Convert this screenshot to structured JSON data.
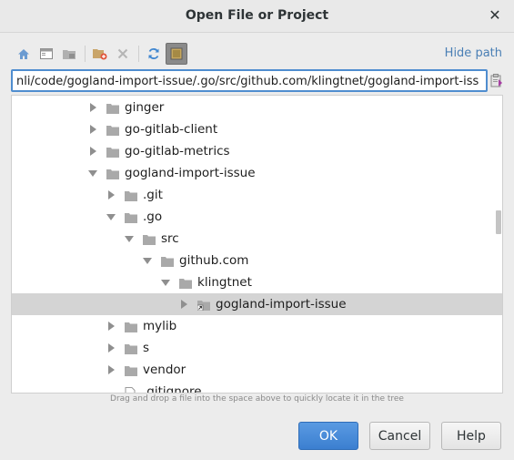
{
  "window": {
    "title": "Open File or Project",
    "close_label": "✕"
  },
  "toolbar": {
    "buttons": [
      {
        "name": "home-button",
        "icon": "home-icon"
      },
      {
        "name": "desktop-button",
        "icon": "desktop-icon"
      },
      {
        "name": "project-button",
        "icon": "project-folder-icon"
      },
      {
        "name": "new-folder-button",
        "icon": "new-folder-icon"
      },
      {
        "name": "delete-button",
        "icon": "delete-icon"
      },
      {
        "name": "refresh-button",
        "icon": "refresh-icon"
      },
      {
        "name": "show-hidden-button",
        "icon": "show-hidden-icon"
      }
    ],
    "hide_path_label": "Hide path"
  },
  "path": {
    "value": "nli/code/gogland-import-issue/.go/src/github.com/klingtnet/gogland-import-iss"
  },
  "tree": {
    "items": [
      {
        "label": "ginger",
        "depth": 0,
        "state": "collapsed",
        "type": "folder",
        "selected": false
      },
      {
        "label": "go-gitlab-client",
        "depth": 0,
        "state": "collapsed",
        "type": "folder",
        "selected": false
      },
      {
        "label": "go-gitlab-metrics",
        "depth": 0,
        "state": "collapsed",
        "type": "folder",
        "selected": false
      },
      {
        "label": "gogland-import-issue",
        "depth": 0,
        "state": "expanded",
        "type": "folder",
        "selected": false
      },
      {
        "label": ".git",
        "depth": 1,
        "state": "collapsed",
        "type": "folder",
        "selected": false
      },
      {
        "label": ".go",
        "depth": 1,
        "state": "expanded",
        "type": "folder",
        "selected": false
      },
      {
        "label": "src",
        "depth": 2,
        "state": "expanded",
        "type": "folder",
        "selected": false
      },
      {
        "label": "github.com",
        "depth": 3,
        "state": "expanded",
        "type": "folder",
        "selected": false
      },
      {
        "label": "klingtnet",
        "depth": 4,
        "state": "expanded",
        "type": "folder",
        "selected": false
      },
      {
        "label": "gogland-import-issue",
        "depth": 5,
        "state": "collapsed",
        "type": "symlink",
        "selected": true
      },
      {
        "label": "mylib",
        "depth": 1,
        "state": "collapsed",
        "type": "folder",
        "selected": false
      },
      {
        "label": "s",
        "depth": 1,
        "state": "collapsed",
        "type": "folder",
        "selected": false
      },
      {
        "label": "vendor",
        "depth": 1,
        "state": "collapsed",
        "type": "folder",
        "selected": false
      },
      {
        "label": ".gitignore",
        "depth": 1,
        "state": "none",
        "type": "file",
        "selected": false
      }
    ]
  },
  "hint": "Drag and drop a file into the space above to quickly locate it in the tree",
  "buttons": {
    "ok": "OK",
    "cancel": "Cancel",
    "help": "Help"
  },
  "colors": {
    "accent": "#4f8dcf",
    "link": "#4a7fb5",
    "selection": "#d4d4d4",
    "primary_button": "#3b7fd0"
  }
}
